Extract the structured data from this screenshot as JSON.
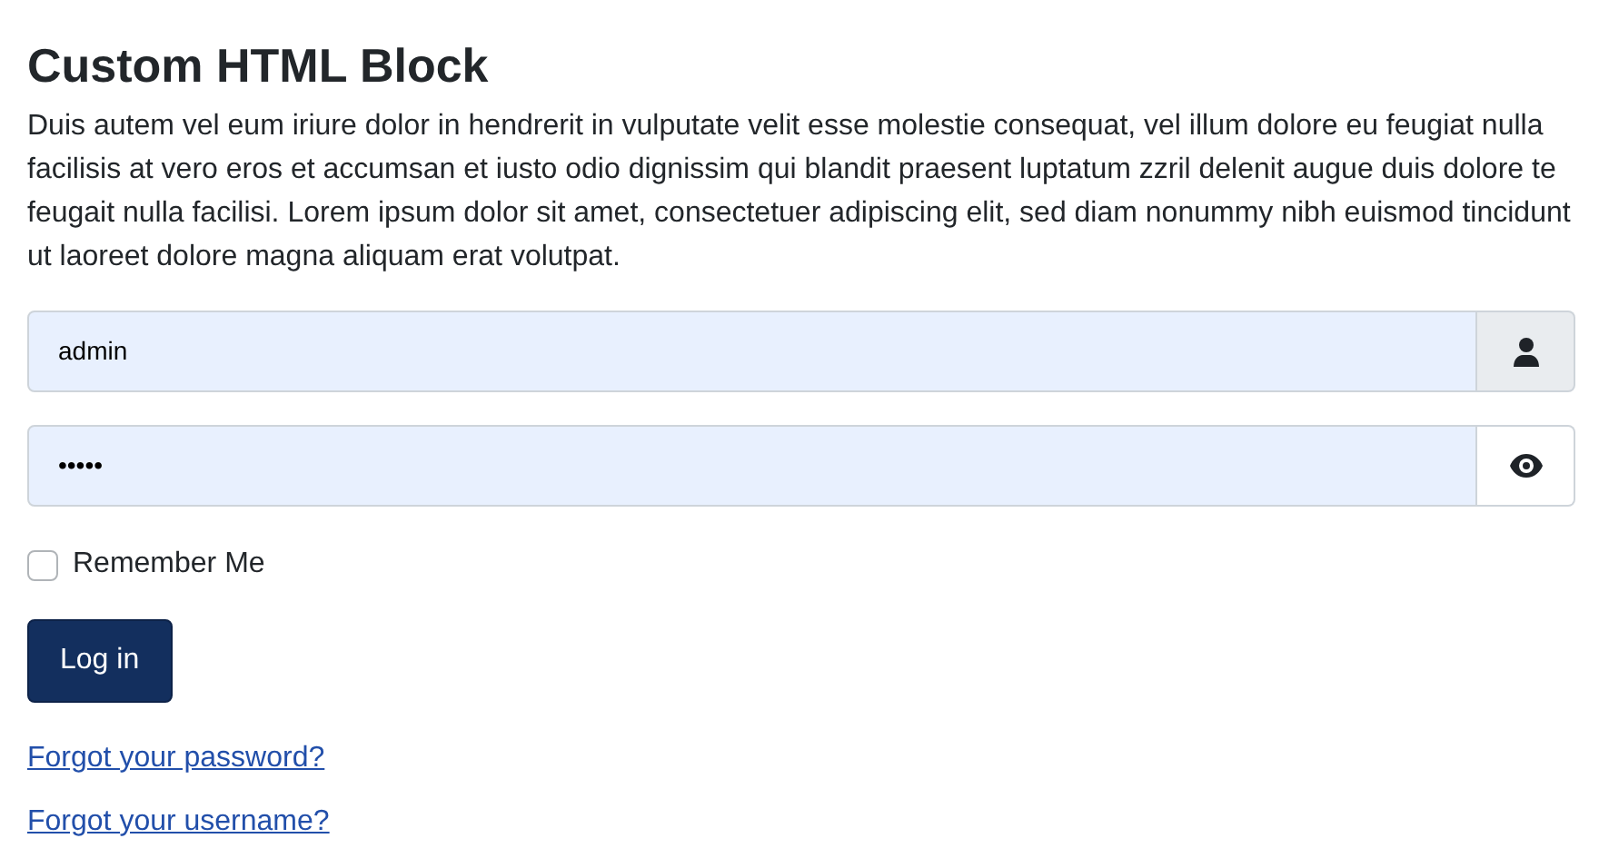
{
  "title": "Custom HTML Block",
  "description": "Duis autem vel eum iriure dolor in hendrerit in vulputate velit esse molestie consequat, vel illum dolore eu feugiat nulla facilisis at vero eros et accumsan et iusto odio dignissim qui blandit praesent luptatum zzril delenit augue duis dolore te feugait nulla facilisi. Lorem ipsum dolor sit amet, consectetuer adipiscing elit, sed diam nonummy nibh euismod tincidunt ut laoreet dolore magna aliquam erat volutpat.",
  "fields": [
    {
      "kind": "username",
      "value": "admin"
    },
    {
      "kind": "password",
      "value": "•••••"
    }
  ],
  "remember": {
    "label": "Remember Me",
    "checked": false
  },
  "login_button": "Log in",
  "links": [
    "Forgot your password?",
    "Forgot your username?"
  ]
}
